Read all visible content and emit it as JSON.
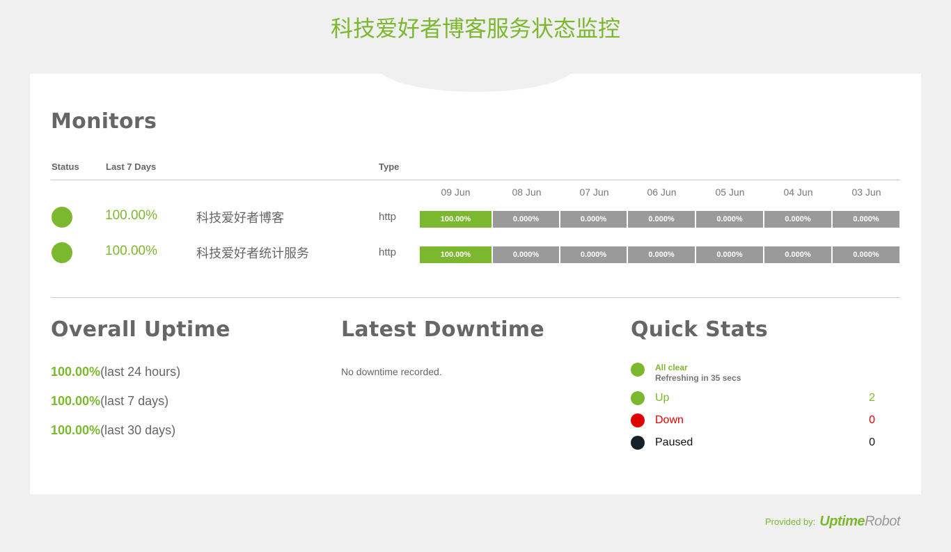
{
  "page": {
    "title": "科技爱好者博客服务状态监控"
  },
  "monitors_section": {
    "title": "Monitors",
    "headers": {
      "status": "Status",
      "last7": "Last 7 Days",
      "type": "Type"
    },
    "dates": [
      "09 Jun",
      "08 Jun",
      "07 Jun",
      "06 Jun",
      "05 Jun",
      "04 Jun",
      "03 Jun"
    ],
    "rows": [
      {
        "status": "up",
        "uptime": "100.00%",
        "name": "科技爱好者博客",
        "type": "http",
        "days": [
          "100.00%",
          "0.000%",
          "0.000%",
          "0.000%",
          "0.000%",
          "0.000%",
          "0.000%"
        ]
      },
      {
        "status": "up",
        "uptime": "100.00%",
        "name": "科技爱好者统计服务",
        "type": "http",
        "days": [
          "100.00%",
          "0.000%",
          "0.000%",
          "0.000%",
          "0.000%",
          "0.000%",
          "0.000%"
        ]
      }
    ]
  },
  "overall": {
    "title": "Overall Uptime",
    "lines": [
      {
        "pct": "100.00%",
        "label": "(last 24 hours)"
      },
      {
        "pct": "100.00%",
        "label": "(last 7 days)"
      },
      {
        "pct": "100.00%",
        "label": "(last 30 days)"
      }
    ]
  },
  "downtime": {
    "title": "Latest Downtime",
    "text": "No downtime recorded."
  },
  "quick_stats": {
    "title": "Quick Stats",
    "all_clear": "All clear",
    "refreshing": "Refreshing in 35 secs",
    "items": [
      {
        "label": "Up",
        "count": "2",
        "color": "#7cb82f"
      },
      {
        "label": "Down",
        "count": "0",
        "color": "#e00000"
      },
      {
        "label": "Paused",
        "count": "0",
        "color": "#17202a"
      }
    ]
  },
  "footer": {
    "provided_by": "Provided by:",
    "brand_part1": "Uptime",
    "brand_part2": "Robot"
  },
  "colors": {
    "accent": "#7cb82f",
    "bar_up": "#7cb82f",
    "bar_none": "#9a9a9a"
  }
}
